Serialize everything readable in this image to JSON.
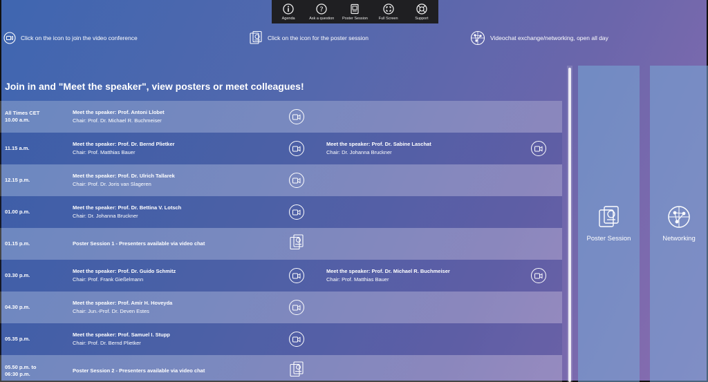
{
  "toolbar": {
    "items": [
      {
        "label": "Agenda",
        "icon": "info-icon"
      },
      {
        "label": "Ask a question",
        "icon": "question-icon"
      },
      {
        "label": "Poster Session",
        "icon": "poster-icon"
      },
      {
        "label": "Full Screen",
        "icon": "fullscreen-icon"
      },
      {
        "label": "Support",
        "icon": "support-icon"
      }
    ]
  },
  "legend": {
    "video": "Click on the icon to join the video conference",
    "poster": "Click on the icon for the poster session",
    "network": "Videochat exchange/networking, open all day"
  },
  "heading": "Join in and \"Meet the speaker\", view posters or meet colleagues!",
  "schedule": [
    {
      "time": "All Times CET\n10.00 a.m.",
      "a_title": "Meet the speaker: Prof. Antoni Llobet",
      "a_chair": "Chair: Prof. Dr. Michael R. Buchmeiser",
      "a_icon": "video",
      "b_title": "",
      "b_chair": "",
      "b_icon": ""
    },
    {
      "time": "11.15 a.m.",
      "a_title": "Meet the speaker: Prof. Dr. Bernd Plietker",
      "a_chair": "Chair: Prof. Matthias Bauer",
      "a_icon": "video",
      "b_title": "Meet the speaker: Prof. Dr. Sabine Laschat",
      "b_chair": "Chair: Dr. Johanna Bruckner",
      "b_icon": "video"
    },
    {
      "time": "12.15 p.m.",
      "a_title": "Meet the speaker: Prof. Dr. Ulrich Tallarek",
      "a_chair": "Chair: Prof. Dr. Joris van Slageren",
      "a_icon": "video",
      "b_title": "",
      "b_chair": "",
      "b_icon": ""
    },
    {
      "time": "01.00 p.m.",
      "a_title": "Meet the speaker: Prof. Dr. Bettina V. Lotsch",
      "a_chair": "Chair: Dr. Johanna Bruckner",
      "a_icon": "video",
      "b_title": "",
      "b_chair": "",
      "b_icon": ""
    },
    {
      "time": "01.15 p.m.",
      "a_title": "Poster Session 1 - Presenters available via video chat",
      "a_chair": "",
      "a_icon": "poster",
      "b_title": "",
      "b_chair": "",
      "b_icon": ""
    },
    {
      "time": "03.30 p.m.",
      "a_title": "Meet the speaker: Prof. Dr. Guido Schmitz",
      "a_chair": "Chair: Prof. Frank Gießelmann",
      "a_icon": "video",
      "b_title": "Meet the speaker: Prof. Dr. Michael R. Buchmeiser",
      "b_chair": "Chair: Prof. Matthias Bauer",
      "b_icon": "video"
    },
    {
      "time": "04.30 p.m.",
      "a_title": "Meet the speaker: Prof. Amir H. Hoveyda",
      "a_chair": "Chair: Jun.-Prof. Dr. Deven Estes",
      "a_icon": "video",
      "b_title": "",
      "b_chair": "",
      "b_icon": ""
    },
    {
      "time": "05.35 p.m.",
      "a_title": "Meet the speaker: Prof. Samuel I. Stupp",
      "a_chair": "Chair: Prof. Dr. Bernd Plietker",
      "a_icon": "video",
      "b_title": "",
      "b_chair": "",
      "b_icon": ""
    },
    {
      "time": "05.50 p.m. to\n06:30 p.m.",
      "a_title": "Poster Session 2 - Presenters available via video chat",
      "a_chair": "",
      "a_icon": "poster",
      "b_title": "",
      "b_chair": "",
      "b_icon": ""
    }
  ],
  "panels": {
    "poster": "Poster Session",
    "network": "Networking"
  }
}
